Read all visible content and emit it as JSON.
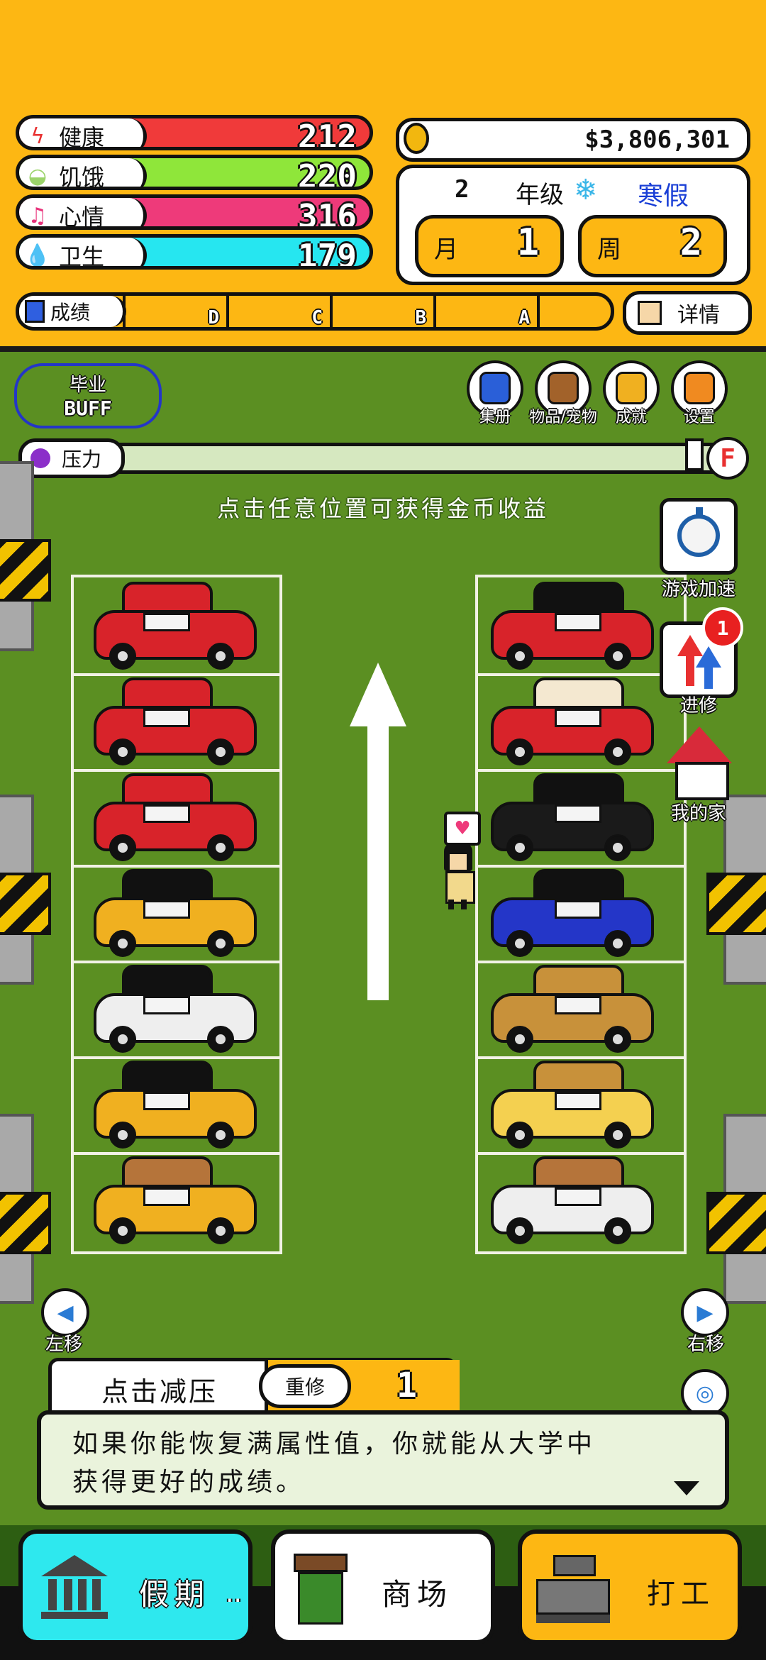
{
  "stats": [
    {
      "label": "健康",
      "value": "212",
      "color": "#f03a3a",
      "icon": "lightning-icon",
      "glyph": "ϟ",
      "icon_color": "#e83030"
    },
    {
      "label": "饥饿",
      "value": "220",
      "color": "#8fe63a",
      "icon": "bowl-icon",
      "glyph": "◒",
      "icon_color": "#9bd36a"
    },
    {
      "label": "心情",
      "value": "316",
      "color": "#ee3a7a",
      "icon": "music-note-icon",
      "glyph": "♫",
      "icon_color": "#e8317a"
    },
    {
      "label": "卫生",
      "value": "179",
      "color": "#26e6f0",
      "icon": "water-drop-icon",
      "glyph": "💧",
      "icon_color": "#22c4e8"
    }
  ],
  "money": {
    "value": "$3,806,301",
    "icon": "coin-icon"
  },
  "calendar": {
    "grade_num": "2",
    "grade_label": "年级",
    "season_icon": "snowflake-icon",
    "season_glyph": "❄",
    "season": "寒假",
    "month_label": "月",
    "month": "1",
    "week_label": "周",
    "week": "2"
  },
  "grades": {
    "label": "成绩",
    "icon": "report-card-icon",
    "levels": [
      "D",
      "C",
      "B",
      "A"
    ]
  },
  "details": {
    "label": "详情",
    "icon": "face-icon"
  },
  "graduation": {
    "line1": "毕业",
    "line2": "BUFF"
  },
  "top_icons": [
    {
      "label": "集册",
      "name": "album-icon"
    },
    {
      "label": "物品/宠物",
      "name": "chest-icon"
    },
    {
      "label": "成就",
      "name": "achievement-icon"
    },
    {
      "label": "设置",
      "name": "settings-gear-icon"
    }
  ],
  "pressure": {
    "label": "压力",
    "icon": "skull-icon",
    "level_grade": "F",
    "fill_fraction": 0.0
  },
  "hint": "点击任意位置可获得金币收益",
  "side_buttons": [
    {
      "label": "游戏加速",
      "name": "stopwatch-icon"
    },
    {
      "label": "进修",
      "name": "upgrade-arrows-icon",
      "badge": "1"
    },
    {
      "label": "我的家",
      "name": "home-icon"
    }
  ],
  "nav": {
    "left": "左移",
    "right": "右移",
    "center": "居中"
  },
  "relief": {
    "label": "点击减压",
    "retake_label": "重修",
    "retake_count": "1"
  },
  "dialog": {
    "line1": "如果你能恢复满属性值，你就能从大学中",
    "line2": "获得更好的成绩。"
  },
  "bottom": [
    {
      "label": "假期",
      "suffix": "..",
      "icon": "bank-icon",
      "color": "#2ee8ee"
    },
    {
      "label": "商场",
      "icon": "shopping-bag-icon",
      "color": "#ffffff"
    },
    {
      "label": "打工",
      "icon": "cash-register-icon",
      "color": "#fdb713"
    }
  ],
  "colors": {
    "panel": "#fdb713",
    "grass": "#5b8f22"
  }
}
